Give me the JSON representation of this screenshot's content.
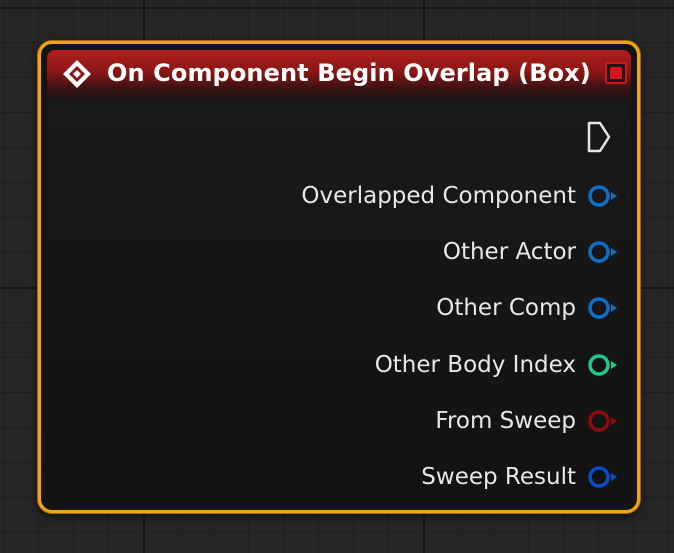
{
  "node": {
    "title": "On Component Begin Overlap (Box)",
    "icon": "event-diamond-icon",
    "delegate_pin_color": "#d6141c",
    "header_color": "#a81a1a",
    "border_color": "#f0a417",
    "exec_pin": "exec-output-pin-icon",
    "pins": [
      {
        "label": "Overlapped Component",
        "type": "object",
        "color": "#0f6fc6",
        "icon": "object-pin-icon"
      },
      {
        "label": "Other Actor",
        "type": "object",
        "color": "#0f6fc6",
        "icon": "object-pin-icon"
      },
      {
        "label": "Other Comp",
        "type": "object",
        "color": "#0f6fc6",
        "icon": "object-pin-icon"
      },
      {
        "label": "Other Body Index",
        "type": "integer",
        "color": "#1ec98a",
        "icon": "integer-pin-icon"
      },
      {
        "label": "From Sweep",
        "type": "boolean",
        "color": "#8c0b0b",
        "icon": "boolean-pin-icon"
      },
      {
        "label": "Sweep Result",
        "type": "struct",
        "color": "#0a4ec6",
        "icon": "struct-pin-icon"
      }
    ]
  }
}
